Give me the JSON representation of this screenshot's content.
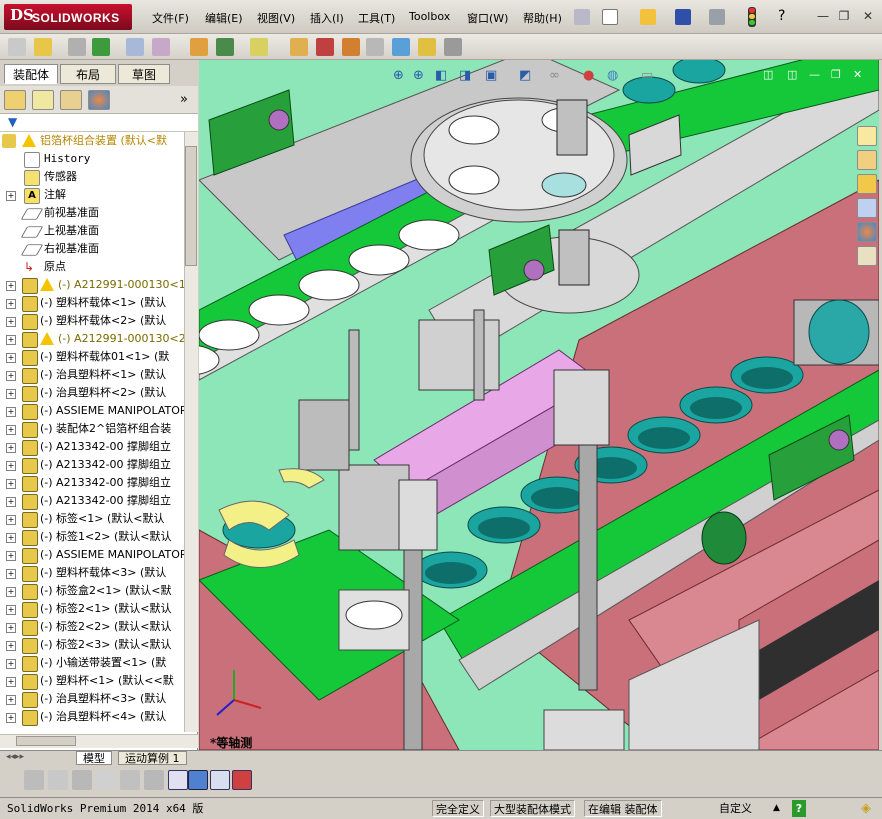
{
  "app": {
    "logo_ds": "DS",
    "logo_name": "SOLIDWORKS"
  },
  "menu": [
    "文件(F)",
    "编辑(E)",
    "视图(V)",
    "插入(I)",
    "工具(T)",
    "Toolbox",
    "窗口(W)",
    "帮助(H)"
  ],
  "window_buttons": {
    "minimize": "—",
    "restore": "❐",
    "close": "✕"
  },
  "panel_tabs": [
    "装配体",
    "布局",
    "草图"
  ],
  "tree": {
    "root": "铝箔杯组合装置  (默认<默",
    "fixed_items": [
      "History",
      "传感器",
      "注解",
      "前视基准面",
      "上视基准面",
      "右视基准面",
      "原点"
    ],
    "components": [
      {
        "label": "(-) A212991-000130<1",
        "warn": true
      },
      {
        "label": "(-) 塑料杯载体<1> (默认",
        "warn": false
      },
      {
        "label": "(-) 塑料杯载体<2> (默认",
        "warn": false
      },
      {
        "label": "(-) A212991-000130<2",
        "warn": true
      },
      {
        "label": "(-) 塑料杯载体01<1> (默",
        "warn": false
      },
      {
        "label": "(-) 治具塑料杯<1> (默认",
        "warn": false
      },
      {
        "label": "(-) 治具塑料杯<2> (默认",
        "warn": false
      },
      {
        "label": "(-) ASSIEME MANIPOLATOR",
        "warn": false
      },
      {
        "label": "(-) 装配体2^铝箔杯组合装",
        "warn": false
      },
      {
        "label": "(-) A213342-00 撑脚组立",
        "warn": false
      },
      {
        "label": "(-) A213342-00 撑脚组立",
        "warn": false
      },
      {
        "label": "(-) A213342-00 撑脚组立",
        "warn": false
      },
      {
        "label": "(-) A213342-00 撑脚组立",
        "warn": false
      },
      {
        "label": "(-) 标签<1> (默认<默认",
        "warn": false
      },
      {
        "label": "(-) 标签1<2> (默认<默认",
        "warn": false
      },
      {
        "label": "(-) ASSIEME MANIPOLATOR",
        "warn": false
      },
      {
        "label": "(-) 塑料杯载体<3> (默认",
        "warn": false
      },
      {
        "label": "(-) 标签盒2<1> (默认<默",
        "warn": false
      },
      {
        "label": "(-) 标签2<1> (默认<默认",
        "warn": false
      },
      {
        "label": "(-) 标签2<2> (默认<默认",
        "warn": false
      },
      {
        "label": "(-) 标签2<3> (默认<默认",
        "warn": false
      },
      {
        "label": "(-) 小输送带装置<1> (默",
        "warn": false
      },
      {
        "label": "(-) 塑料杯<1> (默认<<默",
        "warn": false
      },
      {
        "label": "(-) 治具塑料杯<3> (默认",
        "warn": false
      },
      {
        "label": "(-) 治具塑料杯<4> (默认",
        "warn": false
      }
    ]
  },
  "view_label": "*等轴测",
  "model_tabs": [
    "模型",
    "运动算例 1"
  ],
  "status": {
    "product": "SolidWorks Premium 2014 x64 版",
    "underdefined": "完全定义",
    "large_assembly": "大型装配体模式",
    "editing": "在编辑 装配体",
    "custom": "自定义",
    "help": "?"
  },
  "colors": {
    "background_green": "#8de6b8",
    "conveyor_green": "#15c83a",
    "frame_red": "#c9707a",
    "cup_teal": "#1aa5a0",
    "lavender_block": "#e8a8e8",
    "blue_plate": "#7f7ff0",
    "bracket_green": "#27a03c"
  }
}
